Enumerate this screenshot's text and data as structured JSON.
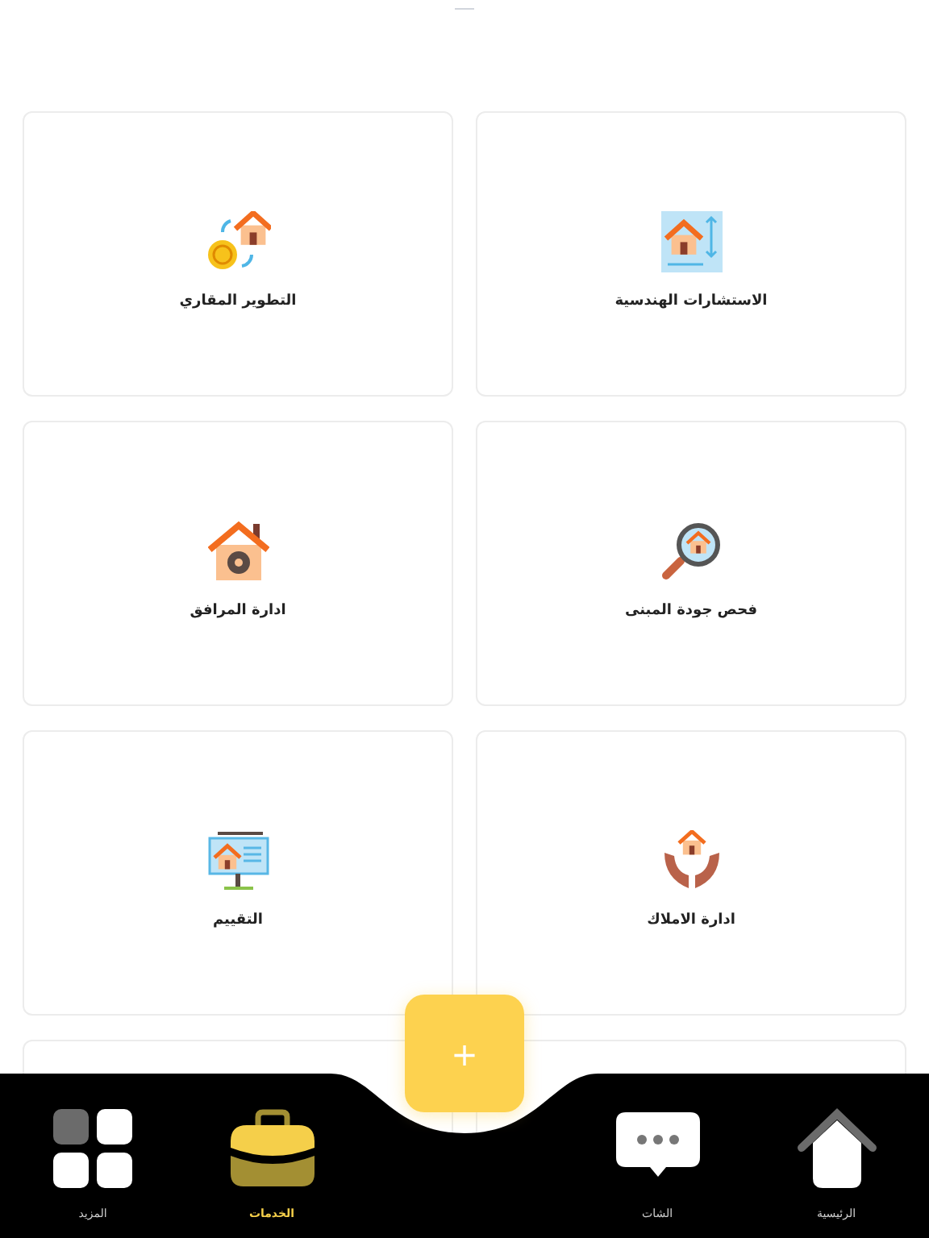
{
  "services": [
    {
      "label": "الاستشارات الهندسية"
    },
    {
      "label": "التطوير المقاري"
    },
    {
      "label": "فحص جودة  المبنى"
    },
    {
      "label": "ادارة المرافق"
    },
    {
      "label": "ادارة الاملاك"
    },
    {
      "label": "التقييم"
    }
  ],
  "fab": {
    "label": "+"
  },
  "nav": [
    {
      "label": "الرئيسية",
      "selected": false
    },
    {
      "label": "الشات",
      "selected": false
    },
    {
      "label": "الخدمات",
      "selected": true
    },
    {
      "label": "المزيد",
      "selected": false
    }
  ]
}
